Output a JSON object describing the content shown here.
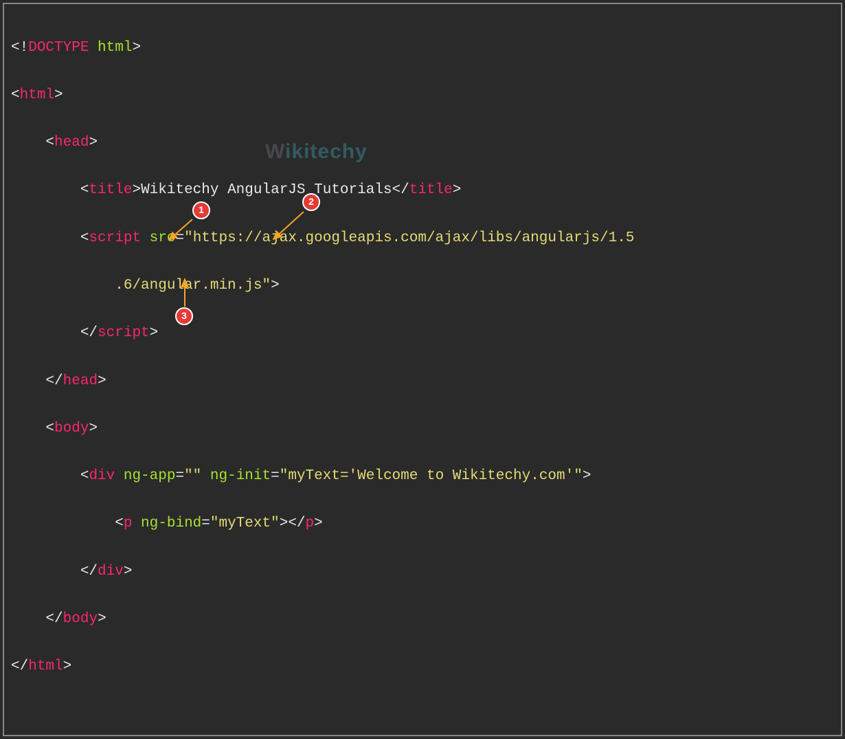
{
  "code": {
    "l1_doctype_open": "<!",
    "l1_doctype_tag": "DOCTYPE",
    "l1_doctype_attr": " html",
    "l1_doctype_close": ">",
    "l2_open": "<",
    "l2_tag": "html",
    "l2_close": ">",
    "l3_open": "<",
    "l3_tag": "head",
    "l3_close": ">",
    "l4_open": "<",
    "l4_tag": "title",
    "l4_close1": ">",
    "l4_text": "Wikitechy AngularJS Tutorials",
    "l4_open2": "</",
    "l4_close2": ">",
    "l5_open": "<",
    "l5_tag": "script",
    "l5_attr": " src",
    "l5_eq": "=",
    "l5_val": "\"https://ajax.googleapis.com/ajax/libs/angularjs/1.5",
    "l6_val": ".6/angular.min.js\"",
    "l6_close": ">",
    "l7_open": "</",
    "l7_tag": "script",
    "l7_close": ">",
    "l8_open": "</",
    "l8_tag": "head",
    "l8_close": ">",
    "l9_open": "<",
    "l9_tag": "body",
    "l9_close": ">",
    "l10_open": "<",
    "l10_tag": "div",
    "l10_a1": " ng-app",
    "l10_eq1": "=",
    "l10_v1": "\"\"",
    "l10_a2": " ng-init",
    "l10_eq2": "=",
    "l10_v2": "\"myText='Welcome to Wikitechy.com'\"",
    "l10_close": ">",
    "l11_open": "<",
    "l11_tag": "p",
    "l11_a1": " ng-bind",
    "l11_eq1": "=",
    "l11_v1": "\"myText\"",
    "l11_close1": ">",
    "l11_open2": "</",
    "l11_close2": ">",
    "l12_open": "</",
    "l12_tag": "div",
    "l12_close": ">",
    "l13_open": "</",
    "l13_tag": "body",
    "l13_close": ">",
    "l14_open": "</",
    "l14_tag": "html",
    "l14_close": ">"
  },
  "callouts": {
    "c1": "1",
    "c2": "2",
    "c3": "3"
  },
  "watermark": {
    "w": "W",
    "rest": "ikitechy"
  }
}
